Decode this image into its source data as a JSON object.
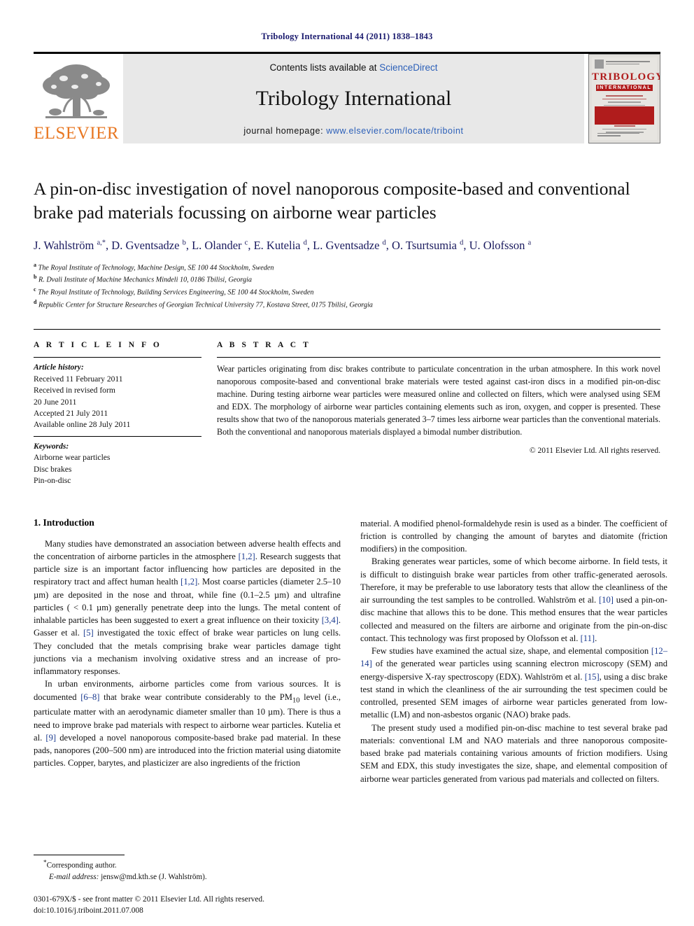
{
  "running_head": "Tribology International 44 (2011) 1838–1843",
  "banner": {
    "publisher_logo_text": "ELSEVIER",
    "contents_prefix": "Contents lists available at ",
    "contents_link": "ScienceDirect",
    "journal_title": "Tribology International",
    "homepage_prefix": "journal homepage: ",
    "homepage_url": "www.elsevier.com/locate/triboint",
    "cover_title_main": "TRIBOLOGY",
    "cover_title_sub": "INTERNATIONAL",
    "link_color": "#2b5fb8",
    "elsevier_orange": "#E87722",
    "cover_red": "#b01c1c"
  },
  "title": "A pin-on-disc investigation of novel nanoporous composite-based and conventional brake pad materials focussing on airborne wear particles",
  "authors_html": "J. Wahlström <sup>a,*</sup>, D. Gventsadze <sup>b</sup>, L. Olander <sup>c</sup>, E. Kutelia <sup>d</sup>, L. Gventsadze <sup>d</sup>, O. Tsurtsumia <sup>d</sup>, U. Olofsson <sup>a</sup>",
  "affiliations": [
    {
      "marker": "a",
      "text": "The Royal Institute of Technology, Machine Design, SE 100 44 Stockholm, Sweden"
    },
    {
      "marker": "b",
      "text": "R. Dvali Institute of Machine Mechanics Mindeli 10, 0186 Tbilisi, Georgia"
    },
    {
      "marker": "c",
      "text": "The Royal Institute of Technology, Building Services Engineering, SE 100 44 Stockholm, Sweden"
    },
    {
      "marker": "d",
      "text": "Republic Center for Structure Researches of Georgian Technical University 77, Kostava Street, 0175 Tbilisi, Georgia"
    }
  ],
  "article_info": {
    "heading": "A R T I C L E   I N F O",
    "history_label": "Article history:",
    "history": [
      "Received 11 February 2011",
      "Received in revised form",
      "20 June 2011",
      "Accepted 21 July 2011",
      "Available online 28 July 2011"
    ],
    "keywords_label": "Keywords:",
    "keywords": [
      "Airborne wear particles",
      "Disc brakes",
      "Pin-on-disc"
    ]
  },
  "abstract": {
    "heading": "A B S T R A C T",
    "text": "Wear particles originating from disc brakes contribute to particulate concentration in the urban atmosphere. In this work novel nanoporous composite-based and conventional brake materials were tested against cast-iron discs in a modified pin-on-disc machine. During testing airborne wear particles were measured online and collected on filters, which were analysed using SEM and EDX. The morphology of airborne wear particles containing elements such as iron, oxygen, and copper is presented. These results show that two of the nanoporous materials generated 3–7 times less airborne wear particles than the conventional materials. Both the conventional and nanoporous materials displayed a bimodal number distribution.",
    "copyright": "© 2011 Elsevier Ltd. All rights reserved."
  },
  "introduction": {
    "heading": "1. Introduction",
    "left_paragraphs": [
      "Many studies have demonstrated an association between adverse health effects and the concentration of airborne particles in the atmosphere [1,2]. Research suggests that particle size is an important factor influencing how particles are deposited in the respiratory tract and affect human health [1,2]. Most coarse particles (diameter 2.5–10 µm) are deposited in the nose and throat, while fine (0.1–2.5 µm) and ultrafine particles ( < 0.1 µm) generally penetrate deep into the lungs. The metal content of inhalable particles has been suggested to exert a great influence on their toxicity [3,4]. Gasser et al. [5] investigated the toxic effect of brake wear particles on lung cells. They concluded that the metals comprising brake wear particles damage tight junctions via a mechanism involving oxidative stress and an increase of pro-inflammatory responses.",
      "In urban environments, airborne particles come from various sources. It is documented [6–8] that brake wear contribute considerably to the PM10 level (i.e., particulate matter with an aerodynamic diameter smaller than 10 µm). There is thus a need to improve brake pad materials with respect to airborne wear particles. Kutelia et al. [9] developed a novel nanoporous composite-based brake pad material. In these pads, nanopores (200–500 nm) are introduced into the friction material using diatomite particles. Copper, barytes, and plasticizer are also ingredients of the friction"
    ],
    "right_paragraphs": [
      "material. A modified phenol-formaldehyde resin is used as a binder. The coefficient of friction is controlled by changing the amount of barytes and diatomite (friction modifiers) in the composition.",
      "Braking generates wear particles, some of which become airborne. In field tests, it is difficult to distinguish brake wear particles from other traffic-generated aerosols. Therefore, it may be preferable to use laboratory tests that allow the cleanliness of the air surrounding the test samples to be controlled. Wahlström et al. [10] used a pin-on-disc machine that allows this to be done. This method ensures that the wear particles collected and measured on the filters are airborne and originate from the pin-on-disc contact. This technology was first proposed by Olofsson et al. [11].",
      "Few studies have examined the actual size, shape, and elemental composition [12–14] of the generated wear particles using scanning electron microscopy (SEM) and energy-dispersive X-ray spectroscopy (EDX). Wahlström et al. [15], using a disc brake test stand in which the cleanliness of the air surrounding the test specimen could be controlled, presented SEM images of airborne wear particles generated from low-metallic (LM) and non-asbestos organic (NAO) brake pads.",
      "The present study used a modified pin-on-disc machine to test several brake pad materials: conventional LM and NAO materials and three nanoporous composite-based brake pad materials containing various amounts of friction modifiers. Using SEM and EDX, this study investigates the size, shape, and elemental composition of airborne wear particles generated from various pad materials and collected on filters."
    ]
  },
  "footnote": {
    "corresponding_marker": "*",
    "corresponding_text": "Corresponding author.",
    "email_label": "E-mail address:",
    "email_value": "jensw@md.kth.se (J. Wahlström)."
  },
  "issn_line": "0301-679X/$ - see front matter © 2011 Elsevier Ltd. All rights reserved.",
  "doi_line": "doi:10.1016/j.triboint.2011.07.008"
}
